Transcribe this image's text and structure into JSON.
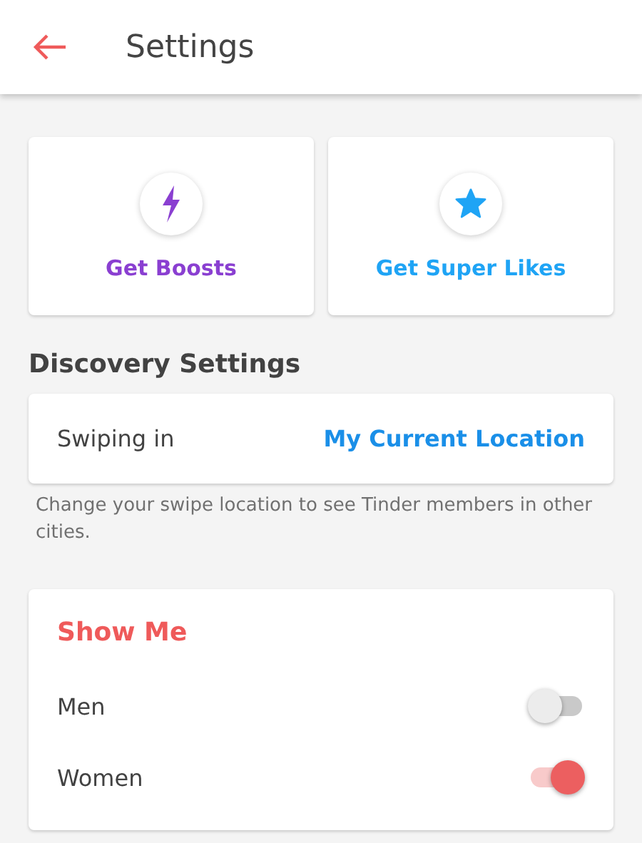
{
  "header": {
    "title": "Settings"
  },
  "promos": [
    {
      "label": "Get Boosts",
      "kind": "bolt",
      "color": "#8a3fd1"
    },
    {
      "label": "Get Super Likes",
      "kind": "star",
      "color": "#1fa4f5"
    }
  ],
  "discovery": {
    "heading": "Discovery Settings",
    "row": {
      "label": "Swiping in",
      "value": "My Current Location"
    },
    "caption": "Change your swipe location to see Tinder members in other cities."
  },
  "show_me": {
    "heading": "Show Me",
    "options": [
      {
        "label": "Men",
        "on": false
      },
      {
        "label": "Women",
        "on": true
      }
    ]
  }
}
